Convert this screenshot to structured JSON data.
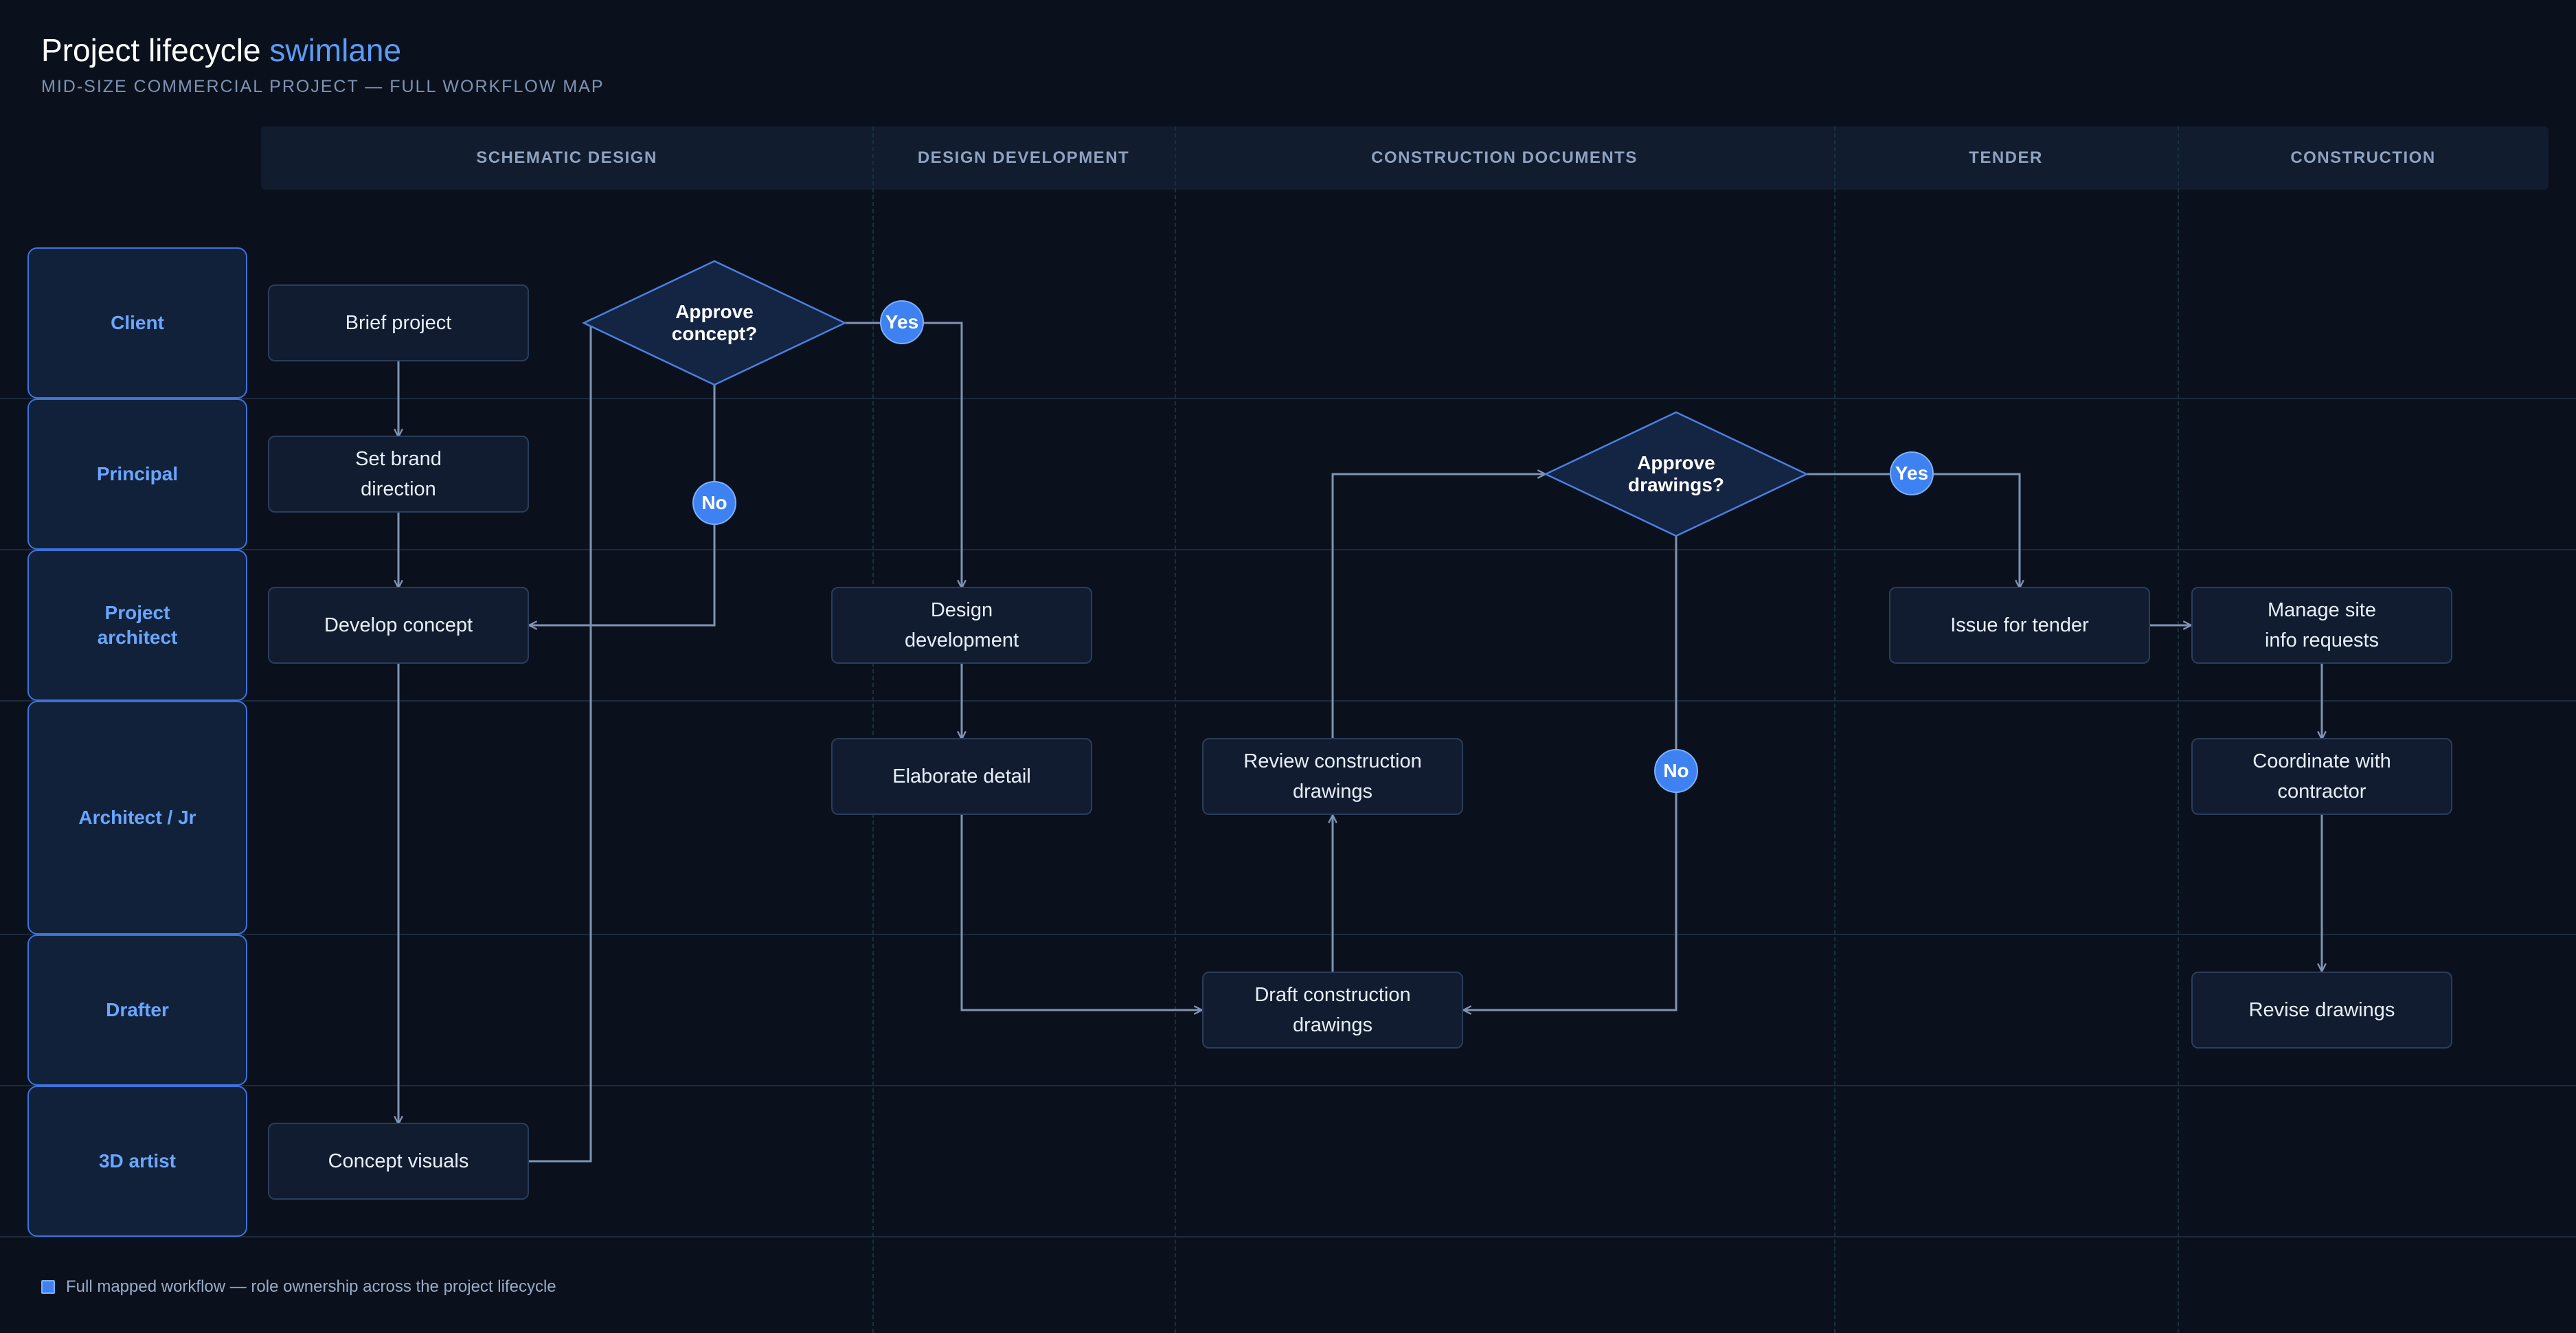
{
  "header": {
    "title_main": "Project lifecycle",
    "title_accent": "swimlane",
    "subtitle": "MID-SIZE COMMERCIAL PROJECT — FULL WORKFLOW MAP"
  },
  "phases": [
    "SCHEMATIC DESIGN",
    "DESIGN DEVELOPMENT",
    "CONSTRUCTION DOCUMENTS",
    "TENDER",
    "CONSTRUCTION"
  ],
  "lanes": [
    [
      "Client"
    ],
    [
      "Principal"
    ],
    [
      "Project",
      "architect"
    ],
    [
      "Architect / Jr"
    ],
    [
      "Drafter"
    ],
    [
      "3D artist"
    ]
  ],
  "nodes": {
    "brief_project": [
      "Brief project"
    ],
    "set_brand_direction": [
      "Set brand",
      "direction"
    ],
    "develop_concept": [
      "Develop concept"
    ],
    "concept_visuals": [
      "Concept visuals"
    ],
    "design_development": [
      "Design",
      "development"
    ],
    "elaborate_detail": [
      "Elaborate detail"
    ],
    "review_construction_drawings": [
      "Review construction",
      "drawings"
    ],
    "draft_construction_drawings": [
      "Draft construction",
      "drawings"
    ],
    "issue_for_tender": [
      "Issue for tender"
    ],
    "manage_site_info_requests": [
      "Manage site",
      "info requests"
    ],
    "coordinate_with_contractor": [
      "Coordinate with",
      "contractor"
    ],
    "revise_drawings": [
      "Revise drawings"
    ]
  },
  "decisions": {
    "approve_concept": [
      "Approve",
      "concept?"
    ],
    "approve_drawings": [
      "Approve",
      "drawings?"
    ]
  },
  "badges": {
    "concept_yes": "Yes",
    "concept_no": "No",
    "drawings_yes": "Yes",
    "drawings_no": "No"
  },
  "colors": {
    "background": "#0a111d",
    "accent": "#5b9cf5",
    "lane_border": "#3d73d9",
    "connector": "#7f93b2",
    "badge": "#3d82f0"
  },
  "legend": {
    "text": "Full mapped workflow — role ownership across the project lifecycle"
  }
}
